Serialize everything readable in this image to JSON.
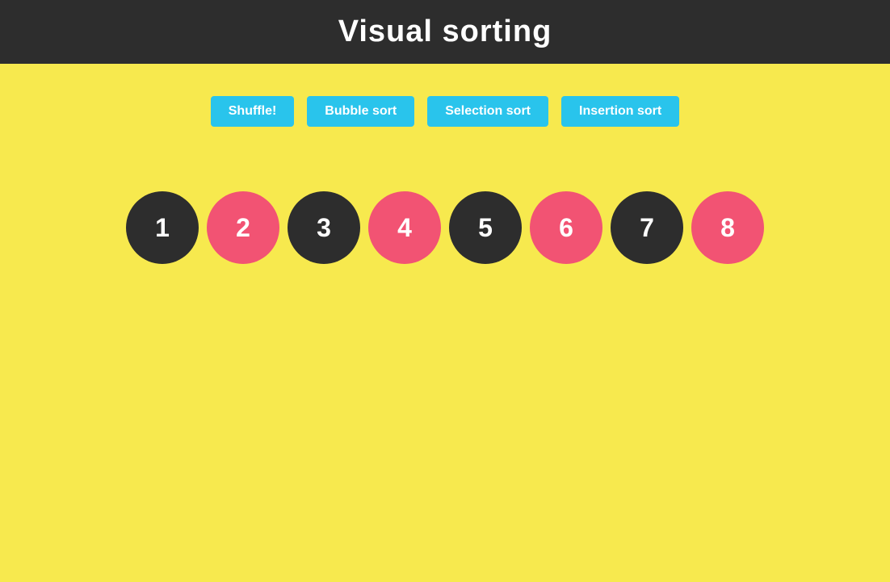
{
  "header": {
    "title": "Visual sorting"
  },
  "toolbar": {
    "buttons": [
      {
        "id": "shuffle",
        "label": "Shuffle!"
      },
      {
        "id": "bubble-sort",
        "label": "Bubble sort"
      },
      {
        "id": "selection-sort",
        "label": "Selection sort"
      },
      {
        "id": "insertion-sort",
        "label": "Insertion sort"
      }
    ]
  },
  "circles": [
    {
      "value": "1",
      "type": "dark"
    },
    {
      "value": "2",
      "type": "pink"
    },
    {
      "value": "3",
      "type": "dark"
    },
    {
      "value": "4",
      "type": "pink"
    },
    {
      "value": "5",
      "type": "dark"
    },
    {
      "value": "6",
      "type": "pink"
    },
    {
      "value": "7",
      "type": "dark"
    },
    {
      "value": "8",
      "type": "pink"
    }
  ]
}
